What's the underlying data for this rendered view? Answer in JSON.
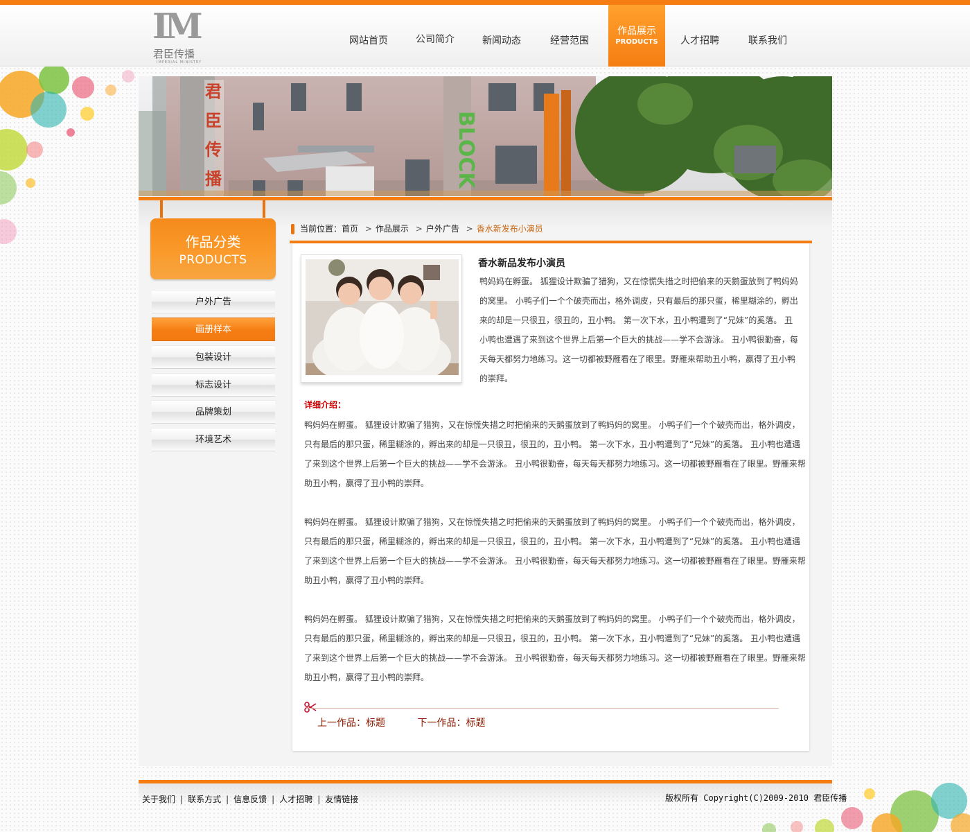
{
  "brand": {
    "mark": "IM",
    "name_cn": "君臣传播",
    "name_en": "IMPERIAL MINISTRY"
  },
  "nav": {
    "items": [
      {
        "label": "网站首页"
      },
      {
        "label": "公司简介"
      },
      {
        "label": "新闻动态"
      },
      {
        "label": "经营范围"
      },
      {
        "label": "作品展示",
        "sub": "PRODUCTS",
        "active": true
      },
      {
        "label": "人才招聘"
      },
      {
        "label": "联系我们"
      }
    ]
  },
  "sidebar": {
    "title": "作品分类",
    "subtitle": "PRODUCTS",
    "items": [
      {
        "label": "户外广告"
      },
      {
        "label": "画册样本",
        "active": true
      },
      {
        "label": "包装设计"
      },
      {
        "label": "标志设计"
      },
      {
        "label": "品牌策划"
      },
      {
        "label": "环境艺术"
      }
    ]
  },
  "breadcrumb": {
    "prefix": "当前位置：",
    "items": [
      "首页",
      "作品展示",
      "户外广告"
    ],
    "current": "香水新发布小演员"
  },
  "work": {
    "title": "香水新品发布小演员",
    "summary": "鸭妈妈在孵蛋。 狐狸设计欺骗了猎狗，又在惊慌失措之时把偷来的天鹅蛋放到了鸭妈妈的窝里。 小鸭子们一个个破壳而出，格外调皮，只有最后的那只蛋，稀里糊涂的，孵出来的却是一只很丑，很丑的，丑小鸭。 第一次下水，丑小鸭遭到了“兄妹”的奚落。 丑小鸭也遭遇了来到这个世界上后第一个巨大的挑战——学不会游泳。 丑小鸭很勤奋，每天每天都努力地练习。这一切都被野雁看在了眼里。野雁来帮助丑小鸭，赢得了丑小鸭的崇拜。",
    "detail_label": "详细介绍：",
    "detail_paragraphs": [
      "鸭妈妈在孵蛋。 狐狸设计欺骗了猎狗，又在惊慌失措之时把偷来的天鹅蛋放到了鸭妈妈的窝里。 小鸭子们一个个破壳而出，格外调皮，只有最后的那只蛋，稀里糊涂的，孵出来的却是一只很丑，很丑的，丑小鸭。 第一次下水，丑小鸭遭到了“兄妹”的奚落。 丑小鸭也遭遇了来到这个世界上后第一个巨大的挑战——学不会游泳。 丑小鸭很勤奋，每天每天都努力地练习。这一切都被野雁看在了眼里。野雁来帮助丑小鸭，赢得了丑小鸭的崇拜。",
      "鸭妈妈在孵蛋。 狐狸设计欺骗了猎狗，又在惊慌失措之时把偷来的天鹅蛋放到了鸭妈妈的窝里。 小鸭子们一个个破壳而出，格外调皮，只有最后的那只蛋，稀里糊涂的，孵出来的却是一只很丑，很丑的，丑小鸭。 第一次下水，丑小鸭遭到了“兄妹”的奚落。 丑小鸭也遭遇了来到这个世界上后第一个巨大的挑战——学不会游泳。 丑小鸭很勤奋，每天每天都努力地练习。这一切都被野雁看在了眼里。野雁来帮助丑小鸭，赢得了丑小鸭的崇拜。",
      "鸭妈妈在孵蛋。 狐狸设计欺骗了猎狗，又在惊慌失措之时把偷来的天鹅蛋放到了鸭妈妈的窝里。 小鸭子们一个个破壳而出，格外调皮，只有最后的那只蛋，稀里糊涂的，孵出来的却是一只很丑，很丑的，丑小鸭。 第一次下水，丑小鸭遭到了“兄妹”的奚落。 丑小鸭也遭遇了来到这个世界上后第一个巨大的挑战——学不会游泳。 丑小鸭很勤奋，每天每天都努力地练习。这一切都被野雁看在了眼里。野雁来帮助丑小鸭，赢得了丑小鸭的崇拜。"
    ],
    "prev_label": "上一作品：标题",
    "next_label": "下一作品：标题"
  },
  "banner": {
    "sign_vertical": "君臣传播",
    "sign_side": "BLOCK"
  },
  "footer": {
    "links": [
      "关于我们",
      "联系方式",
      "信息反馈",
      "人才招聘",
      "友情链接"
    ],
    "copyright_prefix": "版权所有",
    "copyright": " Copyright(C)2009-2010 ",
    "copyright_brand": "君臣传播"
  },
  "colors": {
    "accent": "#f57d12",
    "accent_light": "#ffa12c",
    "link_dark": "#8b1a00",
    "detail_label": "#cc0000"
  },
  "icons": {
    "scissors": "scissors-icon",
    "breadcrumb_separator": "chevron-right-icon"
  }
}
